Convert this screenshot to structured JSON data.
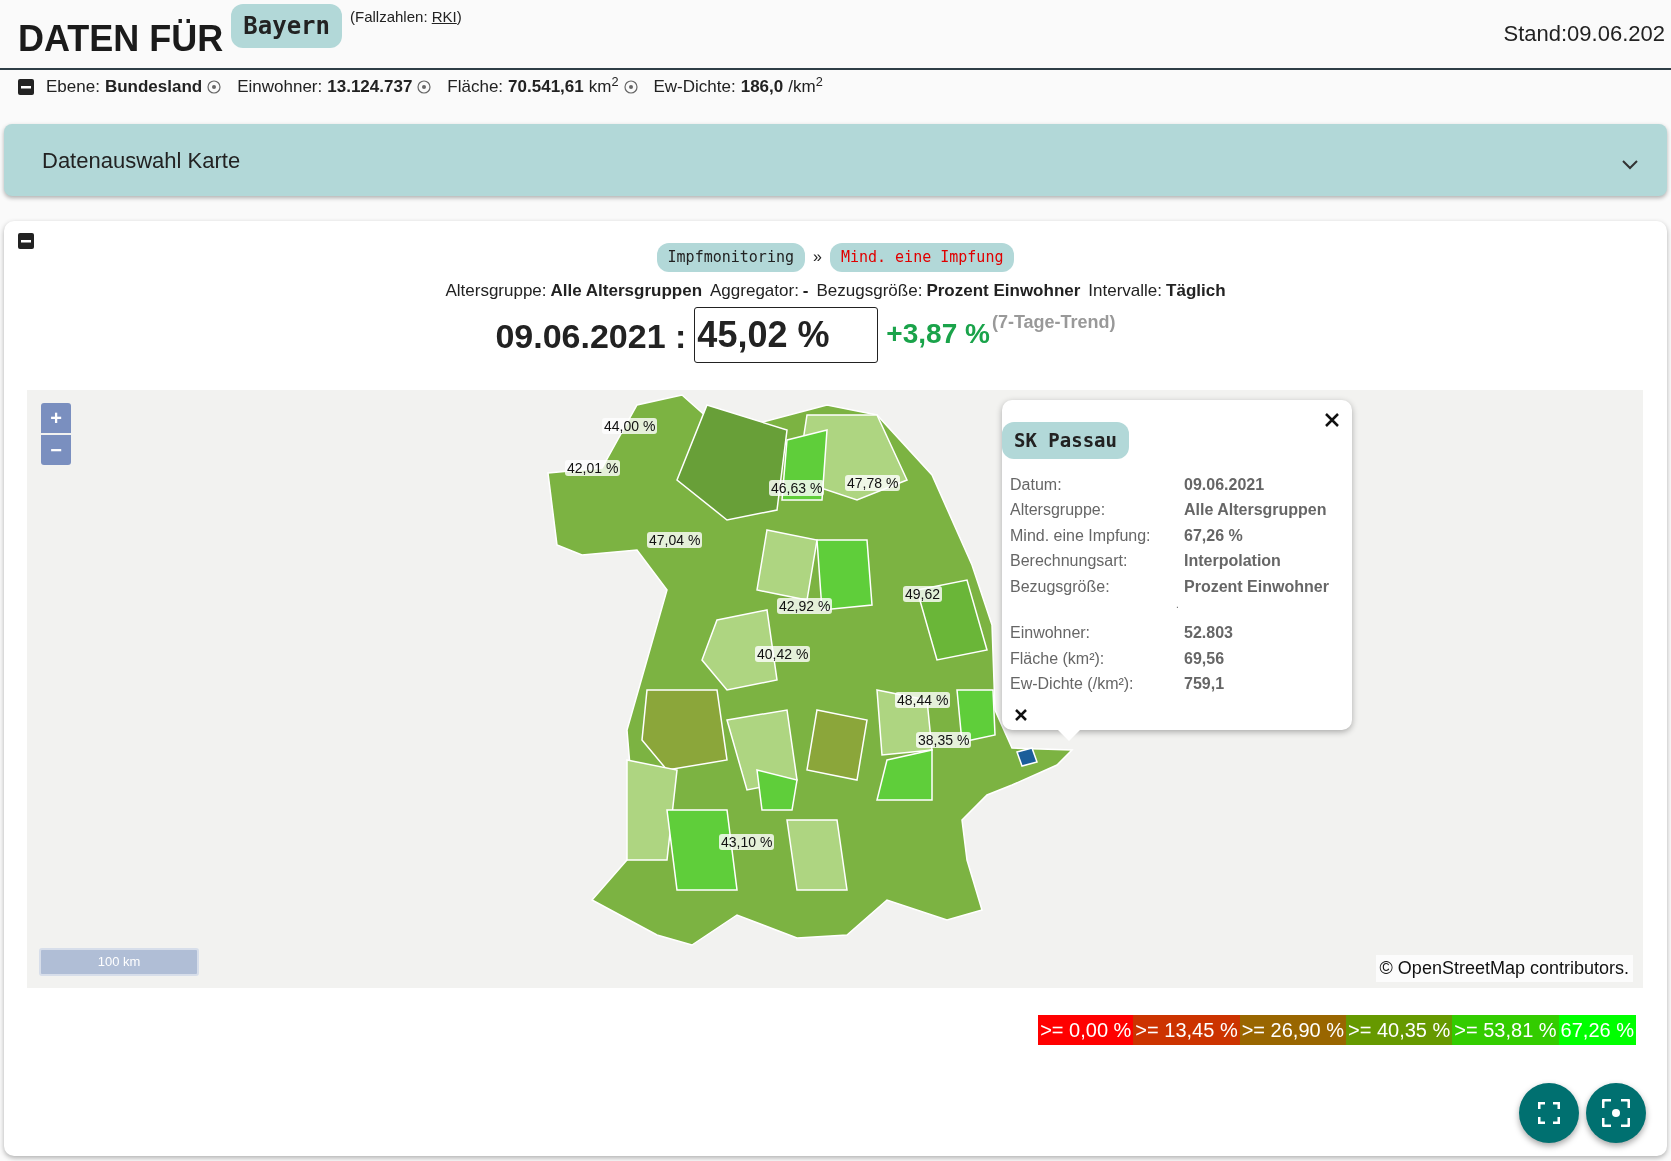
{
  "header": {
    "title": "DATEN FÜR",
    "region": "Bayern",
    "source_prefix": "(Fallzahlen: ",
    "source_link": "RKI",
    "source_suffix": ")",
    "stand": "Stand:09.06.202"
  },
  "info_bar": {
    "expanded": true,
    "items": [
      {
        "label": "Ebene:",
        "value": "Bundesland",
        "info": true
      },
      {
        "label": "Einwohner:",
        "value": "13.124.737",
        "info": true
      },
      {
        "label": "Fläche:",
        "value": "70.541,61",
        "unit": "km$^{2}$",
        "info": true
      },
      {
        "label": "Ew-Dichte:",
        "value": "186,0",
        "unit": "/km$^{2}$",
        "info": false
      }
    ]
  },
  "accordion": {
    "title": "Datenauswahl Karte",
    "expanded": false
  },
  "panel": {
    "expanded": true,
    "breadcrumb": [
      {
        "label": "Impfmonitoring",
        "selected": false
      },
      {
        "label": "Mind. eine Impfung",
        "selected": true
      }
    ],
    "separator": "»",
    "params": [
      {
        "label": "Altersgruppe:",
        "value": "Alle Altersgruppen"
      },
      {
        "label": "Aggregator:",
        "value": "-"
      },
      {
        "label": "Bezugsgröße:",
        "value": "Prozent Einwohner"
      },
      {
        "label": "Intervalle:",
        "value": "Täglich"
      }
    ],
    "date": "09.06.2021 :",
    "value": "45,02 %",
    "trend": "+3,87 %",
    "trend_note": "(7-Tage-Trend)"
  },
  "map": {
    "zoom_in": "+",
    "zoom_out": "−",
    "region_labels": [
      {
        "text": "44,00 %"
      },
      {
        "text": "42,01 %"
      },
      {
        "text": "46,63 %"
      },
      {
        "text": "47,78 %"
      },
      {
        "text": "47,04 %"
      },
      {
        "text": "42,92 %"
      },
      {
        "text": "49,62"
      },
      {
        "text": "40,42 %"
      },
      {
        "text": "48,44 %"
      },
      {
        "text": "38,35 %"
      },
      {
        "text": "43,10 %"
      }
    ],
    "popup": {
      "title": "SK Passau",
      "rows": [
        {
          "kind": "field",
          "label": "Datum:",
          "value": "09.06.2021"
        },
        {
          "kind": "field",
          "label": "Altersgruppe:",
          "value": "Alle Altersgruppen"
        },
        {
          "kind": "field",
          "label": "Mind. eine Impfung:",
          "value": "67,26 %"
        },
        {
          "kind": "field",
          "label": "Berechnungsart:",
          "value": "Interpolation"
        },
        {
          "kind": "field",
          "label": "Bezugsgröße:",
          "value": "Prozent Einwohner"
        },
        {
          "kind": "separator",
          "value": "."
        },
        {
          "kind": "field",
          "label": "Einwohner:",
          "value": "52.803"
        },
        {
          "kind": "field",
          "label": "Fläche (km²):",
          "value": "69,56"
        },
        {
          "kind": "field",
          "label": "Ew-Dichte (/km²):",
          "value": "759,1"
        }
      ]
    },
    "scale": "100 km",
    "attribution": "© OpenStreetMap contributors."
  },
  "legend": [
    {
      "label": ">= 0,00 %",
      "color": "#ff0000"
    },
    {
      "label": ">= 13,45 %",
      "color": "#cc3300"
    },
    {
      "label": ">= 26,90 %",
      "color": "#996600"
    },
    {
      "label": ">= 40,35 %",
      "color": "#669900"
    },
    {
      "label": ">= 53,81 %",
      "color": "#33cc00"
    },
    {
      "label": "67,26 %",
      "color": "#00ff00"
    }
  ]
}
